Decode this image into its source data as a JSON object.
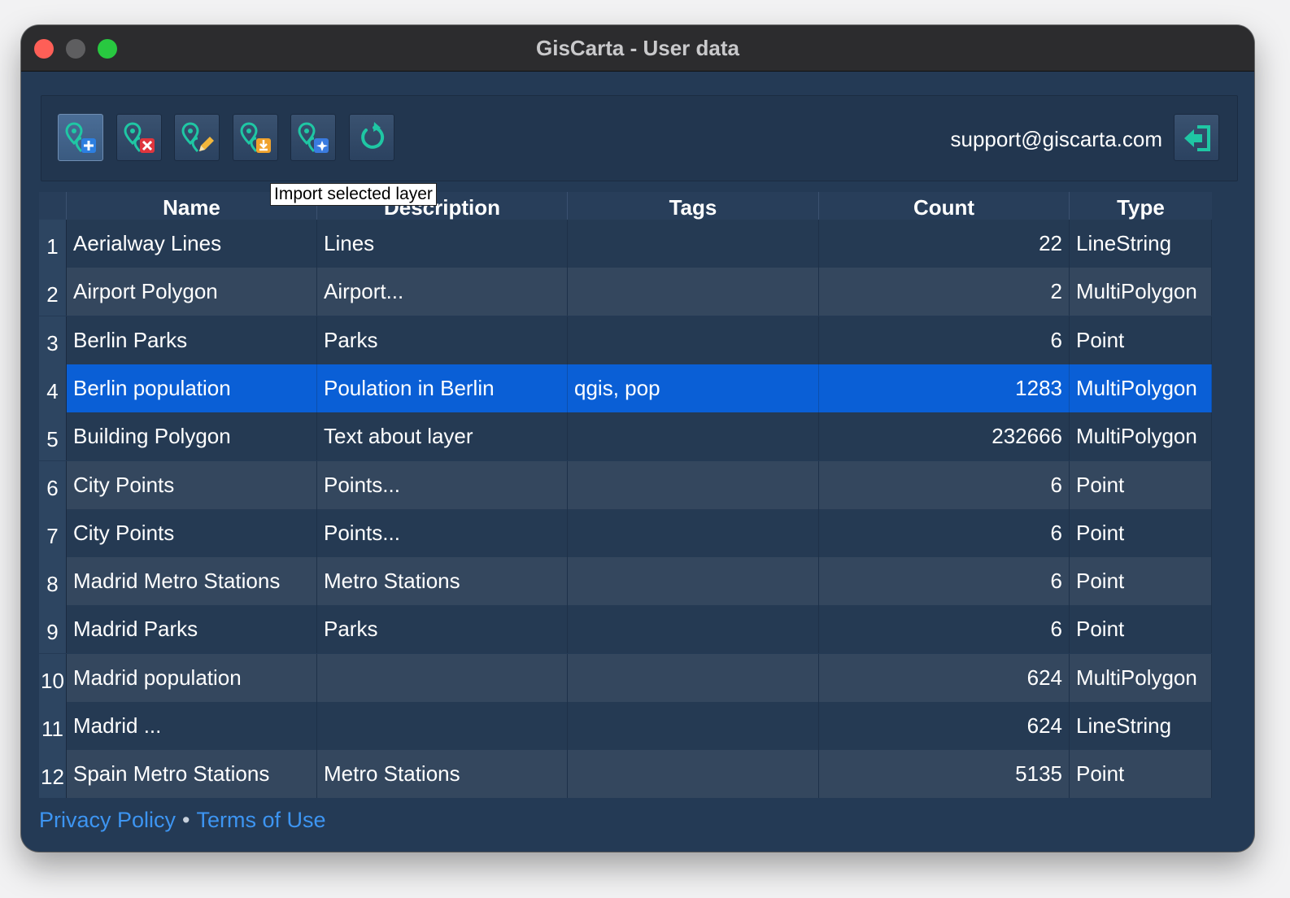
{
  "window": {
    "title": "GisCarta - User data"
  },
  "toolbar": {
    "buttons": [
      {
        "icon": "add-layer-icon",
        "active": true
      },
      {
        "icon": "delete-layer-icon"
      },
      {
        "icon": "edit-layer-icon"
      },
      {
        "icon": "import-layer-icon"
      },
      {
        "icon": "ai-layer-icon"
      },
      {
        "icon": "refresh-icon"
      }
    ],
    "email": "support@giscarta.com",
    "logout_icon": "logout-icon",
    "tooltip": "Import selected layer"
  },
  "table": {
    "headers": [
      "Name",
      "Description",
      "Tags",
      "Count",
      "Type"
    ],
    "selected_row": 4,
    "rows": [
      {
        "n": "1",
        "name": "Aerialway Lines",
        "description": "Lines",
        "tags": "",
        "count": "22",
        "type": "LineString"
      },
      {
        "n": "2",
        "name": "Airport Polygon",
        "description": "Airport...",
        "tags": "",
        "count": "2",
        "type": "MultiPolygon"
      },
      {
        "n": "3",
        "name": "Berlin Parks",
        "description": "Parks",
        "tags": "",
        "count": "6",
        "type": "Point"
      },
      {
        "n": "4",
        "name": "Berlin population",
        "description": "Poulation in Berlin",
        "tags": "qgis, pop",
        "count": "1283",
        "type": "MultiPolygon"
      },
      {
        "n": "5",
        "name": "Building Polygon",
        "description": "Text about layer",
        "tags": "",
        "count": "232666",
        "type": "MultiPolygon"
      },
      {
        "n": "6",
        "name": "City Points",
        "description": "Points...",
        "tags": "",
        "count": "6",
        "type": "Point"
      },
      {
        "n": "7",
        "name": "City Points",
        "description": "Points...",
        "tags": "",
        "count": "6",
        "type": "Point"
      },
      {
        "n": "8",
        "name": "Madrid Metro Stations",
        "description": "Metro Stations",
        "tags": "",
        "count": "6",
        "type": "Point"
      },
      {
        "n": "9",
        "name": "Madrid Parks",
        "description": "Parks",
        "tags": "",
        "count": "6",
        "type": "Point"
      },
      {
        "n": "10",
        "name": "Madrid population",
        "description": "",
        "tags": "",
        "count": "624",
        "type": "MultiPolygon"
      },
      {
        "n": "11",
        "name": "Madrid ...",
        "description": "",
        "tags": "",
        "count": "624",
        "type": "LineString"
      },
      {
        "n": "12",
        "name": "Spain Metro Stations",
        "description": "Metro Stations",
        "tags": "",
        "count": "5135",
        "type": "Point"
      }
    ]
  },
  "footer": {
    "privacy": "Privacy Policy",
    "separator": "•",
    "terms": "Terms of Use"
  },
  "colors": {
    "window_bg": "#243a55",
    "selection": "#0a5fd6",
    "link": "#3d95f2",
    "accent_icon": "#1fc7a4"
  }
}
